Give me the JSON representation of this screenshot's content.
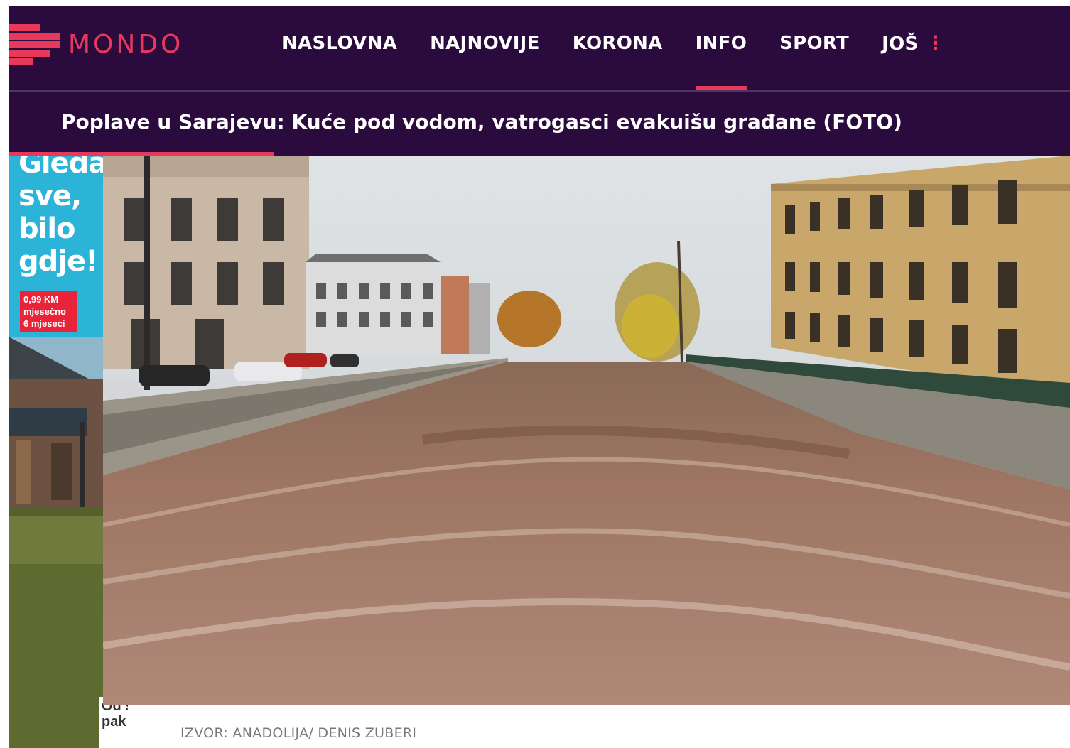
{
  "site": {
    "logo_text": "MONDO",
    "accent_color": "#e8385c",
    "bg_color": "#2b0a3d"
  },
  "nav": {
    "items": [
      {
        "label": "NASLOVNA"
      },
      {
        "label": "NAJNOVIJE"
      },
      {
        "label": "KORONA"
      },
      {
        "label": "INFO",
        "active": true
      },
      {
        "label": "SPORT"
      },
      {
        "label": "JOŠ"
      }
    ],
    "more_icon": "⋮"
  },
  "article": {
    "title": "Poplave u Sarajevu: Kuće pod vodom, vatrogasci evakuišu građane (FOTO)",
    "read_progress": 0.25,
    "photo_caption": "IZVOR: ANADOLIJA/ DENIS ZUBERI"
  },
  "ad": {
    "headline_lines": [
      "Gledaj",
      "sve,",
      "bilo",
      "gdje!"
    ],
    "price_lines": [
      "0,99 KM",
      "mjesečno",
      "6 mjeseci"
    ],
    "footer_partial": "Od s\npak"
  }
}
